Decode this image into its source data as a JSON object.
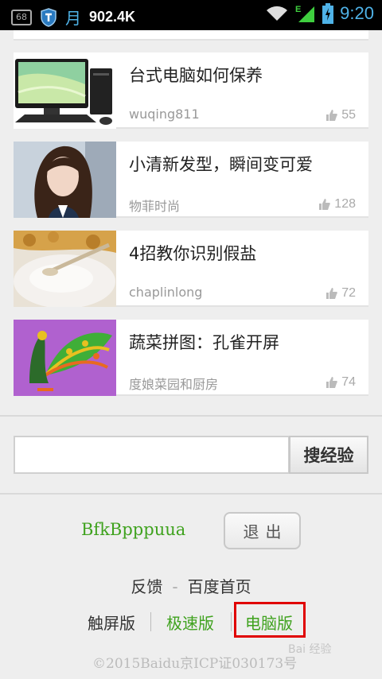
{
  "statusbar": {
    "badge": "68",
    "moon": "月",
    "data_size": "902.4K",
    "signal_label": "E",
    "time": "9:20"
  },
  "cards": [
    {
      "title": "台式电脑如何保养",
      "author": "wuqing811",
      "likes": "55"
    },
    {
      "title": "小清新发型，瞬间变可爱",
      "author": "物菲时尚",
      "likes": "128"
    },
    {
      "title": "4招教你识别假盐",
      "author": "chaplinlong",
      "likes": "72"
    },
    {
      "title": "蔬菜拼图：孔雀开屏",
      "author": "度娘菜园和厨房",
      "likes": "74"
    }
  ],
  "search": {
    "placeholder": "",
    "button_label": "搜经验"
  },
  "footer": {
    "username": "BfkBpppuua",
    "logout_label": "退出",
    "feedback_label": "反馈",
    "separator": "-",
    "home_label": "百度首页",
    "touch_label": "触屏版",
    "fast_label": "极速版",
    "pc_label": "电脑版",
    "copyright": "©2015Baidu京ICP证030173号",
    "watermark": "Bai 经验"
  },
  "colors": {
    "accent_green": "#3fa21e",
    "highlight_red": "#e00000",
    "status_blue": "#4fb3e8"
  }
}
